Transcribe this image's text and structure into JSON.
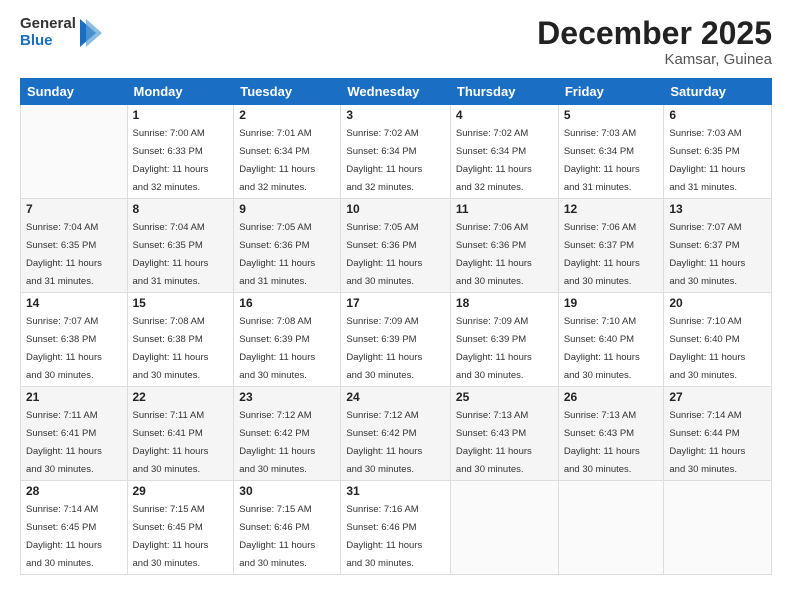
{
  "logo": {
    "text_general": "General",
    "text_blue": "Blue"
  },
  "header": {
    "month": "December 2025",
    "location": "Kamsar, Guinea"
  },
  "weekdays": [
    "Sunday",
    "Monday",
    "Tuesday",
    "Wednesday",
    "Thursday",
    "Friday",
    "Saturday"
  ],
  "weeks": [
    [
      {
        "day": "",
        "info": ""
      },
      {
        "day": "1",
        "info": "Sunrise: 7:00 AM\nSunset: 6:33 PM\nDaylight: 11 hours\nand 32 minutes."
      },
      {
        "day": "2",
        "info": "Sunrise: 7:01 AM\nSunset: 6:34 PM\nDaylight: 11 hours\nand 32 minutes."
      },
      {
        "day": "3",
        "info": "Sunrise: 7:02 AM\nSunset: 6:34 PM\nDaylight: 11 hours\nand 32 minutes."
      },
      {
        "day": "4",
        "info": "Sunrise: 7:02 AM\nSunset: 6:34 PM\nDaylight: 11 hours\nand 32 minutes."
      },
      {
        "day": "5",
        "info": "Sunrise: 7:03 AM\nSunset: 6:34 PM\nDaylight: 11 hours\nand 31 minutes."
      },
      {
        "day": "6",
        "info": "Sunrise: 7:03 AM\nSunset: 6:35 PM\nDaylight: 11 hours\nand 31 minutes."
      }
    ],
    [
      {
        "day": "7",
        "info": "Sunrise: 7:04 AM\nSunset: 6:35 PM\nDaylight: 11 hours\nand 31 minutes."
      },
      {
        "day": "8",
        "info": "Sunrise: 7:04 AM\nSunset: 6:35 PM\nDaylight: 11 hours\nand 31 minutes."
      },
      {
        "day": "9",
        "info": "Sunrise: 7:05 AM\nSunset: 6:36 PM\nDaylight: 11 hours\nand 31 minutes."
      },
      {
        "day": "10",
        "info": "Sunrise: 7:05 AM\nSunset: 6:36 PM\nDaylight: 11 hours\nand 30 minutes."
      },
      {
        "day": "11",
        "info": "Sunrise: 7:06 AM\nSunset: 6:36 PM\nDaylight: 11 hours\nand 30 minutes."
      },
      {
        "day": "12",
        "info": "Sunrise: 7:06 AM\nSunset: 6:37 PM\nDaylight: 11 hours\nand 30 minutes."
      },
      {
        "day": "13",
        "info": "Sunrise: 7:07 AM\nSunset: 6:37 PM\nDaylight: 11 hours\nand 30 minutes."
      }
    ],
    [
      {
        "day": "14",
        "info": "Sunrise: 7:07 AM\nSunset: 6:38 PM\nDaylight: 11 hours\nand 30 minutes."
      },
      {
        "day": "15",
        "info": "Sunrise: 7:08 AM\nSunset: 6:38 PM\nDaylight: 11 hours\nand 30 minutes."
      },
      {
        "day": "16",
        "info": "Sunrise: 7:08 AM\nSunset: 6:39 PM\nDaylight: 11 hours\nand 30 minutes."
      },
      {
        "day": "17",
        "info": "Sunrise: 7:09 AM\nSunset: 6:39 PM\nDaylight: 11 hours\nand 30 minutes."
      },
      {
        "day": "18",
        "info": "Sunrise: 7:09 AM\nSunset: 6:39 PM\nDaylight: 11 hours\nand 30 minutes."
      },
      {
        "day": "19",
        "info": "Sunrise: 7:10 AM\nSunset: 6:40 PM\nDaylight: 11 hours\nand 30 minutes."
      },
      {
        "day": "20",
        "info": "Sunrise: 7:10 AM\nSunset: 6:40 PM\nDaylight: 11 hours\nand 30 minutes."
      }
    ],
    [
      {
        "day": "21",
        "info": "Sunrise: 7:11 AM\nSunset: 6:41 PM\nDaylight: 11 hours\nand 30 minutes."
      },
      {
        "day": "22",
        "info": "Sunrise: 7:11 AM\nSunset: 6:41 PM\nDaylight: 11 hours\nand 30 minutes."
      },
      {
        "day": "23",
        "info": "Sunrise: 7:12 AM\nSunset: 6:42 PM\nDaylight: 11 hours\nand 30 minutes."
      },
      {
        "day": "24",
        "info": "Sunrise: 7:12 AM\nSunset: 6:42 PM\nDaylight: 11 hours\nand 30 minutes."
      },
      {
        "day": "25",
        "info": "Sunrise: 7:13 AM\nSunset: 6:43 PM\nDaylight: 11 hours\nand 30 minutes."
      },
      {
        "day": "26",
        "info": "Sunrise: 7:13 AM\nSunset: 6:43 PM\nDaylight: 11 hours\nand 30 minutes."
      },
      {
        "day": "27",
        "info": "Sunrise: 7:14 AM\nSunset: 6:44 PM\nDaylight: 11 hours\nand 30 minutes."
      }
    ],
    [
      {
        "day": "28",
        "info": "Sunrise: 7:14 AM\nSunset: 6:45 PM\nDaylight: 11 hours\nand 30 minutes."
      },
      {
        "day": "29",
        "info": "Sunrise: 7:15 AM\nSunset: 6:45 PM\nDaylight: 11 hours\nand 30 minutes."
      },
      {
        "day": "30",
        "info": "Sunrise: 7:15 AM\nSunset: 6:46 PM\nDaylight: 11 hours\nand 30 minutes."
      },
      {
        "day": "31",
        "info": "Sunrise: 7:16 AM\nSunset: 6:46 PM\nDaylight: 11 hours\nand 30 minutes."
      },
      {
        "day": "",
        "info": ""
      },
      {
        "day": "",
        "info": ""
      },
      {
        "day": "",
        "info": ""
      }
    ]
  ]
}
